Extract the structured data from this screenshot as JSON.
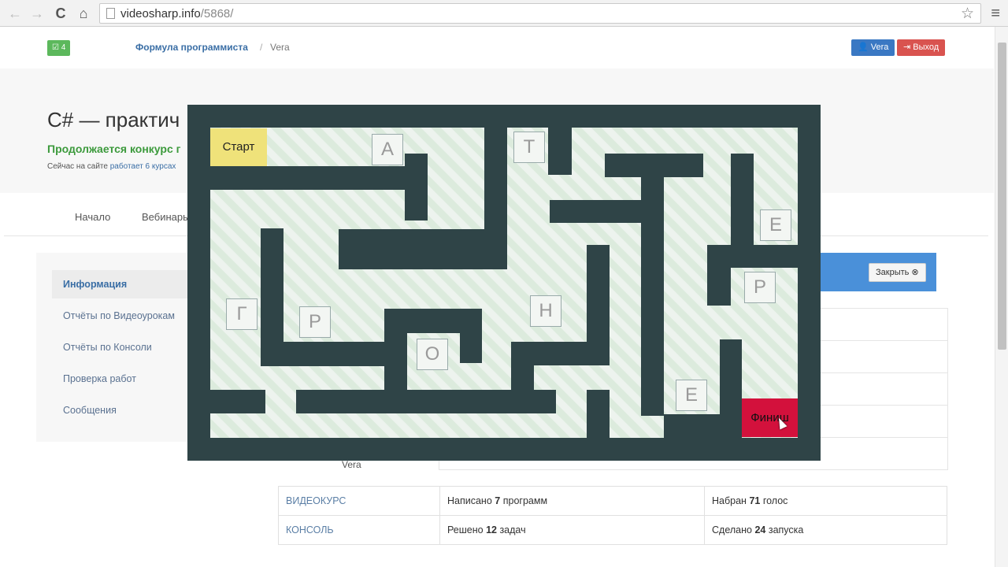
{
  "browser": {
    "url_host": "videosharp.info",
    "url_path": "/5868/",
    "back_icon": "←",
    "forward_icon": "→",
    "reload_icon": "C",
    "home_icon": "⌂",
    "star_icon": "☆",
    "menu_icon": "≡"
  },
  "header": {
    "badge": "☑ 4",
    "breadcrumb_1": "Формула программиста",
    "breadcrumb_sep": "/",
    "breadcrumb_2": "Vera",
    "user_button": "👤 Vera",
    "exit_button": "⇥ Выход"
  },
  "banner": {
    "title": "C# — практич",
    "contest": "Продолжается конкурс г",
    "online_prefix": "Сейчас на сайте",
    "online_link": "работает 6 курсах"
  },
  "tabs": [
    "Начало",
    "Вебинары"
  ],
  "sidebar": {
    "items": [
      {
        "label": "Информация"
      },
      {
        "label": "Отчёты по Видеоурокам"
      },
      {
        "label": "Отчёты по Консоли"
      },
      {
        "label": "Проверка работ"
      },
      {
        "label": "Сообщения"
      }
    ]
  },
  "panel": {
    "close_label": "Закрыть ⊗",
    "vera_label": "Vera"
  },
  "stats": {
    "rows": [
      {
        "label": "ВИДЕОКУРС",
        "mid_prefix": "Написано",
        "mid_num": "7",
        "mid_suffix": "программ",
        "right_prefix": "Набран",
        "right_num": "71",
        "right_suffix": "голос"
      },
      {
        "label": "КОНСОЛЬ",
        "mid_prefix": "Решено",
        "mid_num": "12",
        "mid_suffix": "задач",
        "right_prefix": "Сделано",
        "right_num": "24",
        "right_suffix": "запуска"
      }
    ]
  },
  "maze": {
    "start_label": "Старт",
    "finish_label": "Финиш",
    "letters": [
      "А",
      "Т",
      "Е",
      "Р",
      "Г",
      "Р",
      "Н",
      "О",
      "Е"
    ],
    "colors": {
      "wall": "#2f4447",
      "path": "#e9f2ea",
      "start": "#efe27a",
      "finish": "#d3113c"
    }
  }
}
